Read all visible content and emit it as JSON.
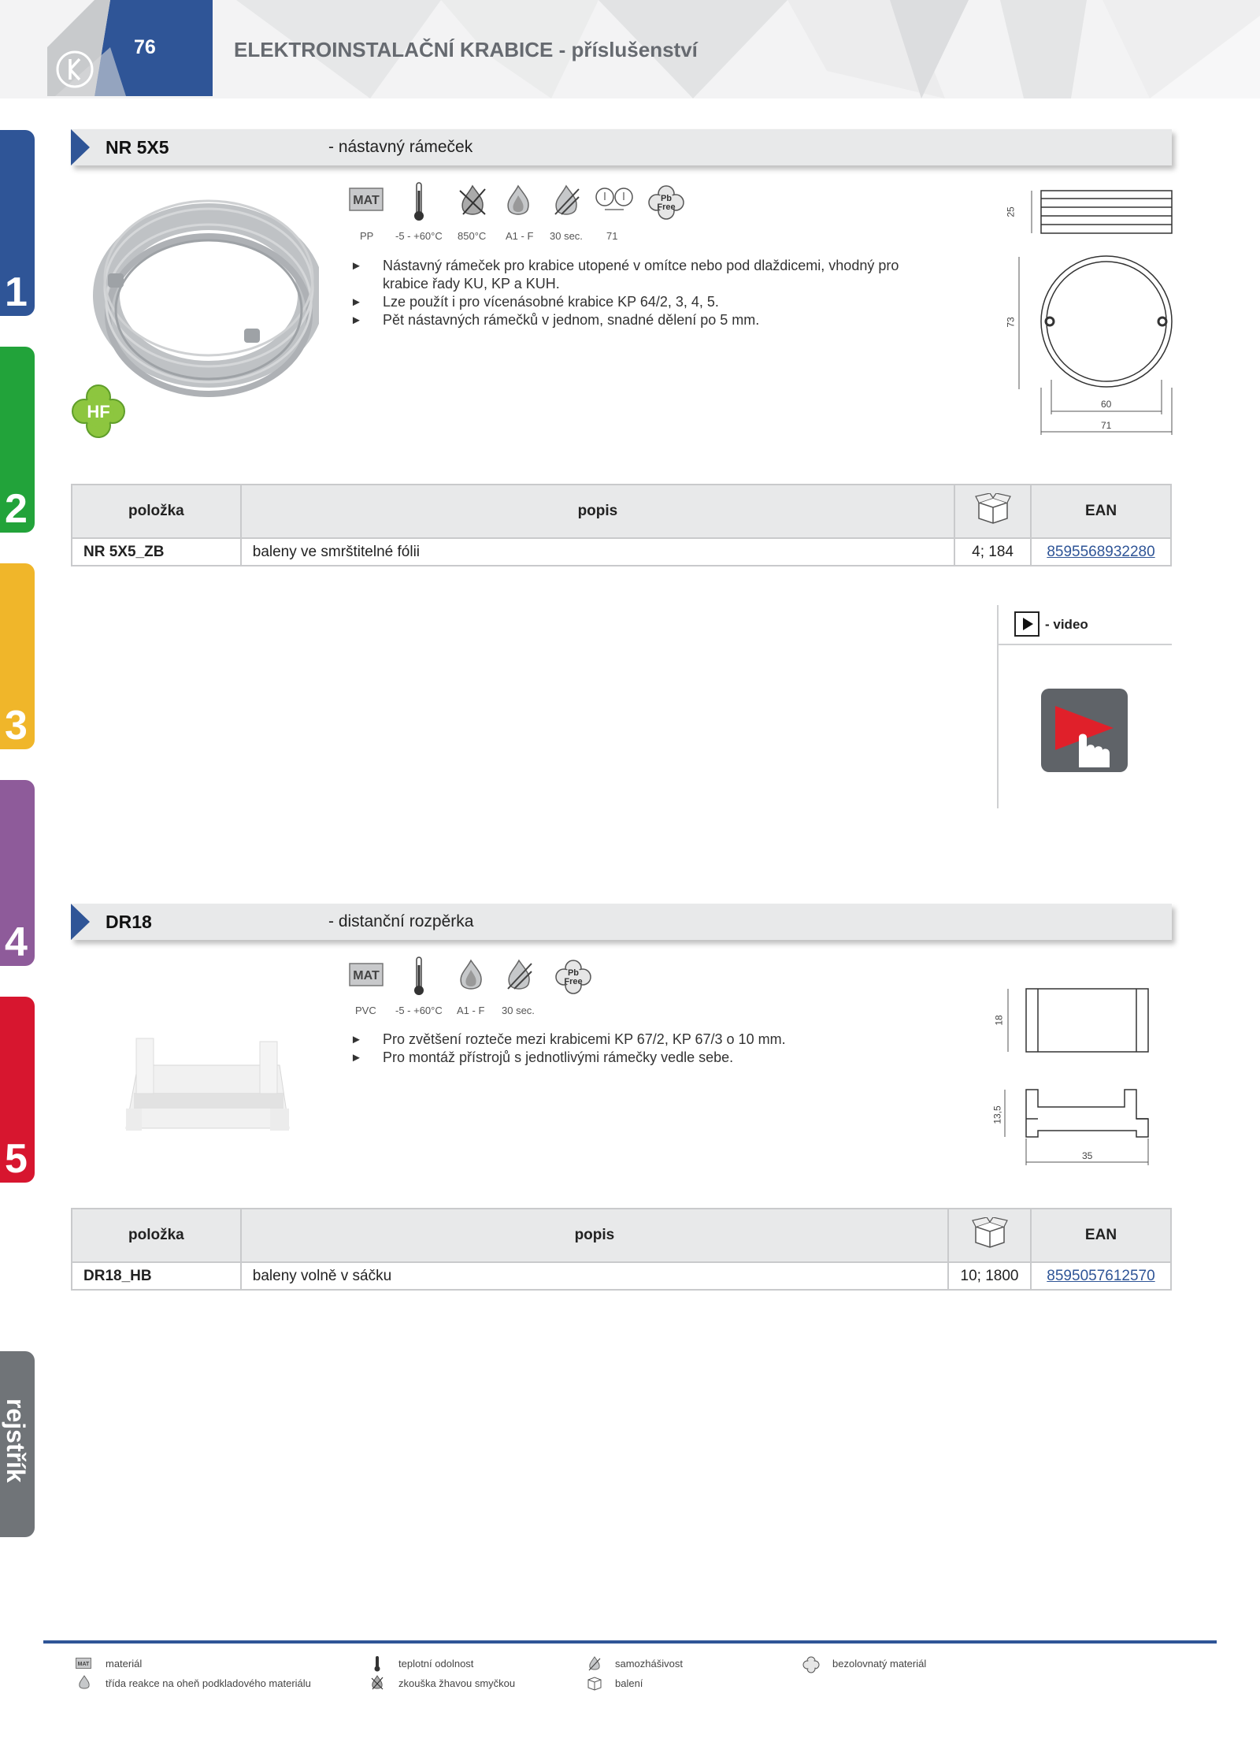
{
  "header": {
    "page_number": "76",
    "title": "ELEKTROINSTALAČNÍ KRABICE - příslušenství"
  },
  "side_tabs": [
    {
      "label": "1",
      "color": "#2f5597"
    },
    {
      "label": "2",
      "color": "#22a33a"
    },
    {
      "label": "3",
      "color": "#f0b62a"
    },
    {
      "label": "4",
      "color": "#8e5b9a"
    },
    {
      "label": "5",
      "color": "#d7162f"
    },
    {
      "label": "rejstřík",
      "color": "#707478"
    }
  ],
  "products": [
    {
      "code": "NR 5X5",
      "subtitle": "- nástavný rámeček",
      "badge": "HF",
      "icon_labels": [
        "PP",
        "-5 - +60°C",
        "850°C",
        "A1 - F",
        "30 sec.",
        "71"
      ],
      "bullets": [
        "Nástavný rámeček pro krabice utopené v omítce nebo pod dlaždicemi, vhodný pro krabice řady KU, KP a KUH.",
        "Lze použít i pro vícenásobné krabice KP 64/2, 3, 4, 5.",
        "Pět nástavných rámečků v jednom, snadné dělení po 5 mm."
      ],
      "dims": [
        "25",
        "73",
        "60",
        "71"
      ],
      "table": {
        "headers": [
          "položka",
          "popis",
          "EAN"
        ],
        "rows": [
          {
            "item": "NR 5X5_ZB",
            "desc": "baleny ve smrštitelné fólii",
            "pack": "4; 184",
            "ean": "8595568932280"
          }
        ]
      }
    },
    {
      "code": "DR18",
      "subtitle": "- distanční rozpěrka",
      "icon_labels": [
        "PVC",
        "-5 - +60°C",
        "A1 - F",
        "30 sec."
      ],
      "bullets": [
        "Pro zvětšení rozteče mezi krabicemi KP 67/2, KP 67/3 o 10 mm.",
        "Pro montáž přístrojů s jednotlivými rámečky vedle sebe."
      ],
      "dims": [
        "18",
        "13,5",
        "35"
      ],
      "table": {
        "headers": [
          "položka",
          "popis",
          "EAN"
        ],
        "rows": [
          {
            "item": "DR18_HB",
            "desc": "baleny volně v sáčku",
            "pack": "10; 1800",
            "ean": "8595057612570"
          }
        ]
      }
    }
  ],
  "video": {
    "label": "- video"
  },
  "icons": {
    "mat": "MAT",
    "pbfree_top": "Pb",
    "pbfree_bottom": "Free"
  },
  "legend": [
    "materiál",
    "třída reakce na oheň podkladového materiálu",
    "teplotní odolnost",
    "zkouška žhavou smyčkou",
    "samozhášivost",
    "balení",
    "bezolovnatý materiál"
  ],
  "colors": {
    "brand_blue": "#2f5597",
    "bar_grey": "#e8e9ea",
    "link": "#2f5597"
  }
}
